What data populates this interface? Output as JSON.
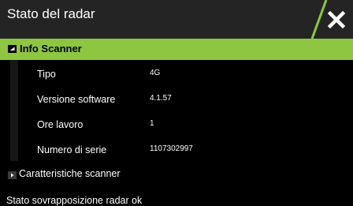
{
  "dialog": {
    "title": "Stato del radar",
    "accent_color": "#8ec641"
  },
  "sections": {
    "scanner_info": {
      "label": "Info Scanner",
      "expanded": true,
      "rows": [
        {
          "name": "Tipo",
          "value": "4G"
        },
        {
          "name": "Versione software",
          "value": "4.1.57"
        },
        {
          "name": "Ore lavoro",
          "value": "1"
        },
        {
          "name": "Numero di serie",
          "value": "1107302997"
        }
      ]
    },
    "scanner_features": {
      "label": "Caratteristiche scanner",
      "expanded": false
    }
  },
  "status": {
    "label": "Stato sovrapposizione radar",
    "value": "ok"
  },
  "icons": {
    "close": "close-icon",
    "expand": "triangle-down-icon",
    "collapse": "triangle-right-icon"
  }
}
